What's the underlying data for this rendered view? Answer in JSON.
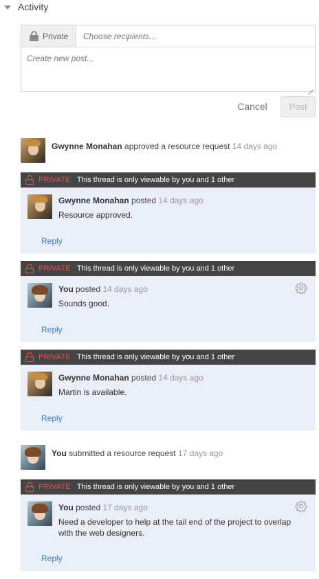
{
  "section": {
    "title": "Activity",
    "caret_icon": "caret-down-icon"
  },
  "composer": {
    "privacy_label": "Private",
    "lock_icon": "lock-icon",
    "recipients_placeholder": "Choose recipients...",
    "post_placeholder": "Create new post...",
    "cancel_label": "Cancel",
    "post_label": "Post"
  },
  "activities": [
    {
      "actor": "Gwynne Monahan",
      "action": "approved a resource request",
      "time": "14 days ago"
    },
    {
      "actor": "You",
      "action": "submitted a resource request",
      "time": "17 days ago"
    }
  ],
  "thread_bar": {
    "private_label": "PRIVATE",
    "message": "This thread is only viewable by you and 1 other"
  },
  "threads": [
    {
      "author": "Gwynne Monahan",
      "verb": "posted",
      "time": "14 days ago",
      "text": "Resource approved.",
      "reply": "Reply"
    },
    {
      "author": "You",
      "verb": "posted",
      "time": "14 days ago",
      "text": "Sounds good.",
      "reply": "Reply"
    },
    {
      "author": "Gwynne Monahan",
      "verb": "posted",
      "time": "14 days ago",
      "text": "Martin is available.",
      "reply": "Reply"
    },
    {
      "author": "You",
      "verb": "posted",
      "time": "17 days ago",
      "text": "Need a developer to help at the tail end of the project to overlap with the web designers.",
      "reply": "Reply"
    }
  ],
  "colors": {
    "private_red": "#e0544f",
    "thread_bar": "#444444",
    "thread_bg": "#e9eef7",
    "link_blue": "#3d7fc1"
  }
}
